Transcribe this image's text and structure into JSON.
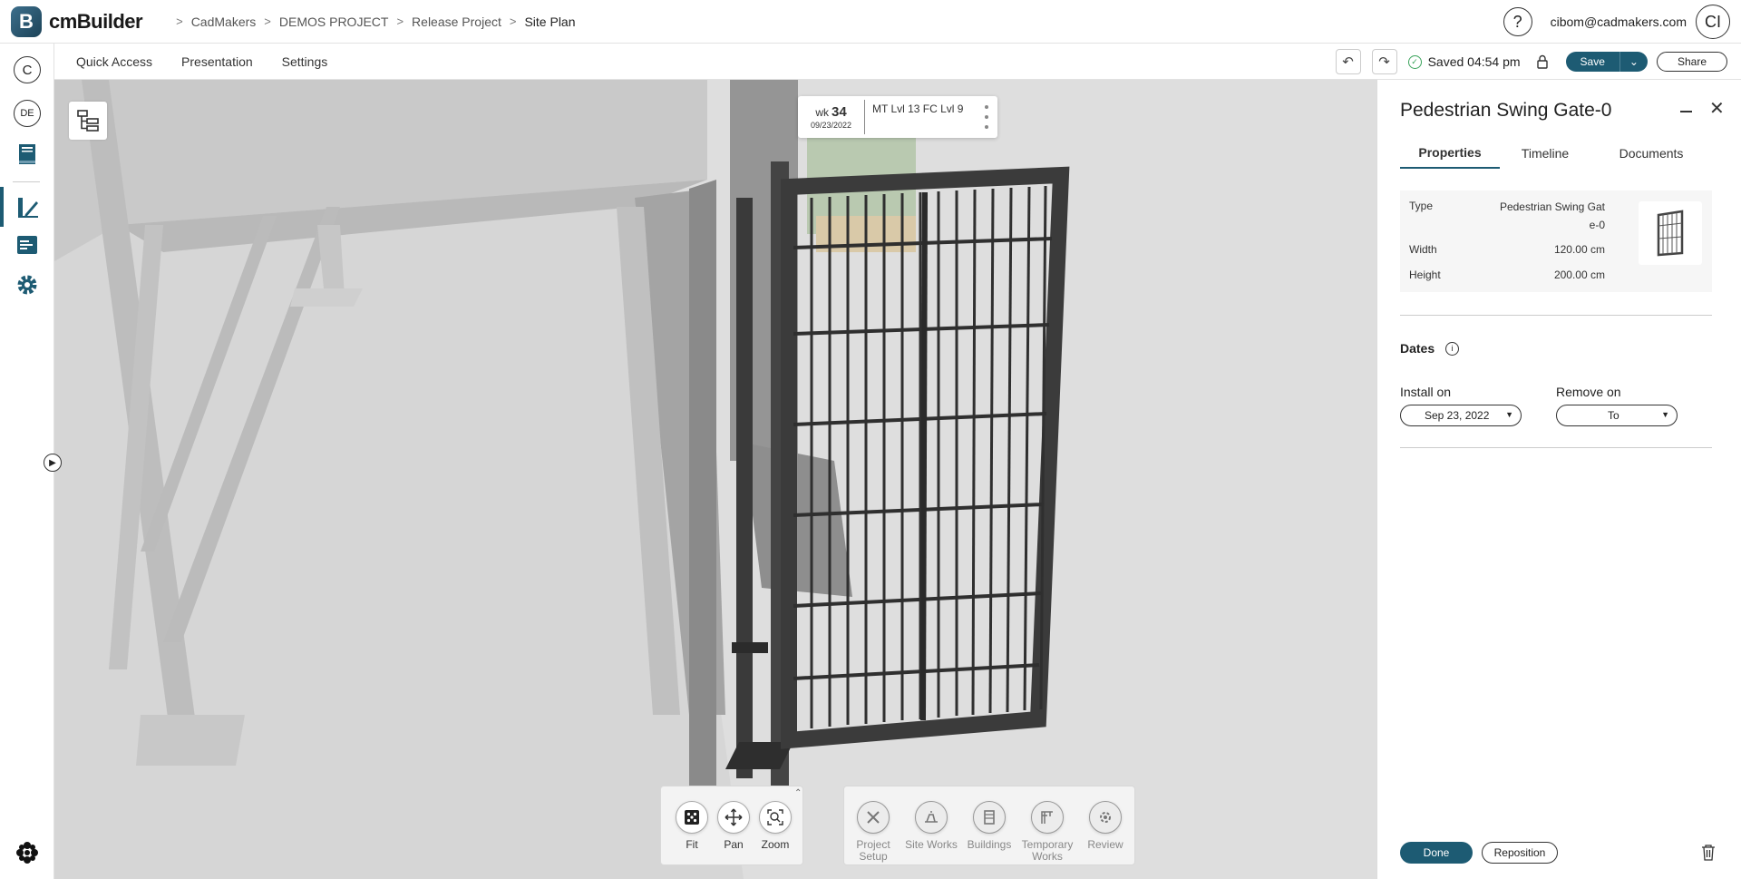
{
  "app": {
    "logo_letter": "B",
    "name": "cmBuilder"
  },
  "breadcrumb": [
    "CadMakers",
    "DEMOS PROJECT",
    "Release Project",
    "Site Plan"
  ],
  "user": {
    "help": "?",
    "email": "cibom@cadmakers.com",
    "initials": "CI"
  },
  "rail": {
    "company_initial": "C",
    "locale": "DE"
  },
  "menu": [
    "Quick Access",
    "Presentation",
    "Settings"
  ],
  "status": {
    "saved_text": "Saved 04:54 pm"
  },
  "actions": {
    "save": "Save",
    "share": "Share"
  },
  "timeline_card": {
    "week_prefix": "wk",
    "week_number": "34",
    "date": "09/23/2022",
    "task": "MT Lvl 13 FC Lvl 9"
  },
  "nav_tools": [
    {
      "label": "Fit",
      "icon": "fit-icon"
    },
    {
      "label": "Pan",
      "icon": "pan-icon"
    },
    {
      "label": "Zoom",
      "icon": "zoom-icon"
    }
  ],
  "mode_tools": [
    {
      "line1": "Project",
      "line2": "Setup",
      "icon": "project-setup-icon"
    },
    {
      "line1": "Site Works",
      "line2": "",
      "icon": "site-works-icon"
    },
    {
      "line1": "Buildings",
      "line2": "",
      "icon": "buildings-icon"
    },
    {
      "line1": "Temporary",
      "line2": "Works",
      "icon": "temporary-works-icon"
    },
    {
      "line1": "Review",
      "line2": "",
      "icon": "review-icon"
    }
  ],
  "panel": {
    "title": "Pedestrian Swing Gate-0",
    "tabs": [
      "Properties",
      "Timeline",
      "Documents"
    ],
    "active_tab": 0,
    "properties": {
      "type_label": "Type",
      "type_value_1": "Pedestrian Swing Gat",
      "type_value_2": "e-0",
      "width_label": "Width",
      "width_value": "120.00 cm",
      "height_label": "Height",
      "height_value": "200.00 cm"
    },
    "dates": {
      "title": "Dates",
      "install_label": "Install on",
      "install_value": "Sep 23, 2022",
      "remove_label": "Remove on",
      "remove_value": "To"
    },
    "done": "Done",
    "reposition": "Reposition"
  },
  "colors": {
    "accent": "#1d5b73",
    "saved_ok": "#3aa35b"
  }
}
